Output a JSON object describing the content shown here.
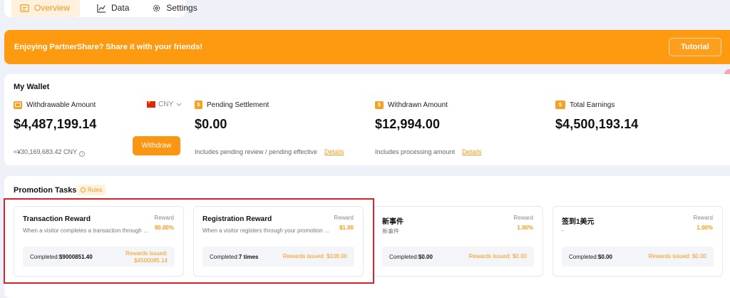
{
  "tabs": [
    {
      "label": "Overview",
      "icon": "overview-icon",
      "active": true
    },
    {
      "label": "Data",
      "icon": "chart-line-icon",
      "active": false
    },
    {
      "label": "Settings",
      "icon": "gear-icon",
      "active": false
    }
  ],
  "banner": {
    "text": "Enjoying PartnerShare? Share it with your friends!",
    "button": "Tutorial"
  },
  "wallet": {
    "title": "My Wallet",
    "currency": "CNY",
    "withdraw_button": "Withdraw",
    "withdrawable": {
      "label": "Withdrawable Amount",
      "value": "$4,487,199.14",
      "note": "≈¥30,169,683.42 CNY"
    },
    "pending": {
      "label": "Pending Settlement",
      "value": "$0.00",
      "note": "Includes pending review / pending effective",
      "link": "Details"
    },
    "withdrawn": {
      "label": "Withdrawn Amount",
      "value": "$12,994.00",
      "note": "Includes processing amount",
      "link": "Details"
    },
    "total": {
      "label": "Total Earnings",
      "value": "$4,500,193.14"
    }
  },
  "promo": {
    "title": "Promotion Tasks",
    "rules": "Rules",
    "reward_label": "Reward",
    "completed_label": "Completed:",
    "issued_label": "Rewards issued:",
    "tasks": [
      {
        "name": "Transaction Reward",
        "desc": "When a visitor completes a transaction through your promotion link",
        "reward": "90.00%",
        "completed": "$9000851.40",
        "issued": "$4500085.14"
      },
      {
        "name": "Registration Reward",
        "desc": "When a visitor registers through your promotion link",
        "reward": "$1.00",
        "completed": "7 times",
        "issued": "$108.00"
      },
      {
        "name": "新事件",
        "desc": "新事件",
        "reward": "1.00%",
        "completed": "$0.00",
        "issued": "$0.00"
      },
      {
        "name": "签到1美元",
        "desc": "-",
        "reward": "1.00%",
        "completed": "$0.00",
        "issued": "$0.00"
      }
    ]
  },
  "colors": {
    "accent": "#fd9a0f",
    "highlight": "#d9232b"
  }
}
